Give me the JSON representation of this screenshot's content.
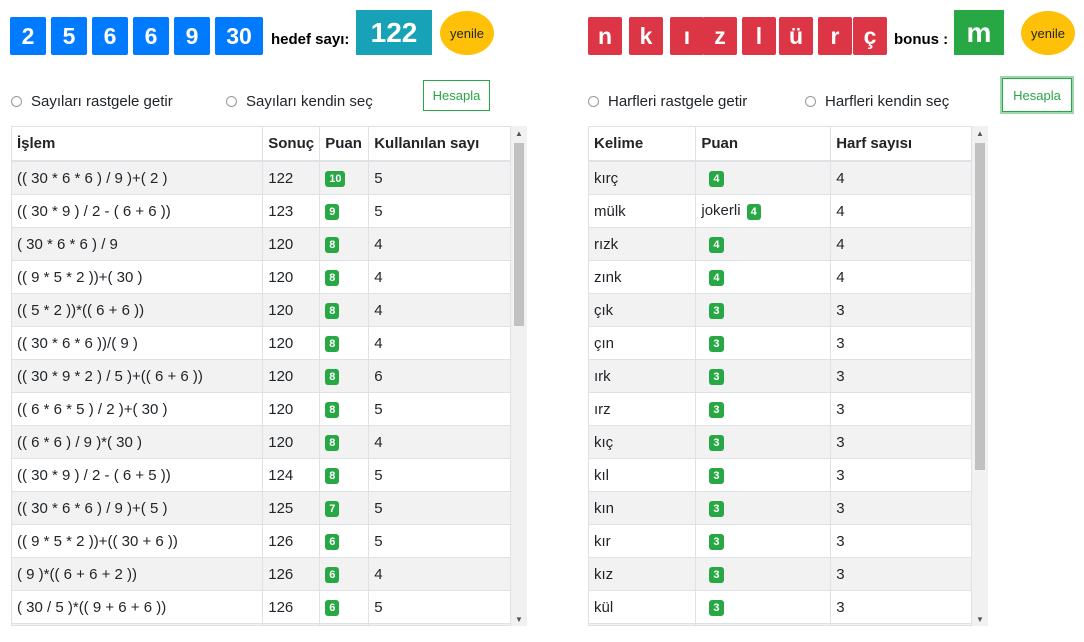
{
  "numbers": {
    "tiles": [
      "2",
      "5",
      "6",
      "6",
      "9",
      "30"
    ],
    "target_label": "hedef sayı:",
    "target_value": "122",
    "refresh_label": "yenile",
    "radio_random": "Sayıları rastgele getir",
    "radio_choose": "Sayıları kendin seç",
    "calculate_label": "Hesapla",
    "table": {
      "headers": [
        "İşlem",
        "Sonuç",
        "Puan",
        "Kullanılan sayı"
      ],
      "rows": [
        {
          "op": "(( 30 * 6 * 6 ) / 9 )+( 2 )",
          "result": "122",
          "score": "10",
          "used": "5"
        },
        {
          "op": "(( 30 * 9 ) / 2 - ( 6 + 6 ))",
          "result": "123",
          "score": "9",
          "used": "5"
        },
        {
          "op": "( 30 * 6 * 6 ) / 9",
          "result": "120",
          "score": "8",
          "used": "4"
        },
        {
          "op": "(( 9 * 5 * 2 ))+( 30 )",
          "result": "120",
          "score": "8",
          "used": "4"
        },
        {
          "op": "(( 5 * 2 ))*(( 6 + 6 ))",
          "result": "120",
          "score": "8",
          "used": "4"
        },
        {
          "op": "(( 30 * 6 * 6 ))/( 9 )",
          "result": "120",
          "score": "8",
          "used": "4"
        },
        {
          "op": "(( 30 * 9 * 2 ) / 5 )+(( 6 + 6 ))",
          "result": "120",
          "score": "8",
          "used": "6"
        },
        {
          "op": "(( 6 * 6 * 5 ) / 2 )+( 30 )",
          "result": "120",
          "score": "8",
          "used": "5"
        },
        {
          "op": "(( 6 * 6 ) / 9 )*( 30 )",
          "result": "120",
          "score": "8",
          "used": "4"
        },
        {
          "op": "(( 30 * 9 ) / 2 - ( 6 + 5 ))",
          "result": "124",
          "score": "8",
          "used": "5"
        },
        {
          "op": "(( 30 * 6 * 6 ) / 9 )+( 5 )",
          "result": "125",
          "score": "7",
          "used": "5"
        },
        {
          "op": "(( 9 * 5 * 2 ))+(( 30 + 6 ))",
          "result": "126",
          "score": "6",
          "used": "5"
        },
        {
          "op": "( 9 )*(( 6 + 6 + 2 ))",
          "result": "126",
          "score": "6",
          "used": "4"
        },
        {
          "op": "( 30 / 5 )*(( 9 + 6 + 6 ))",
          "result": "126",
          "score": "6",
          "used": "5"
        },
        {
          "op": "",
          "result": "",
          "score": "",
          "used": ""
        }
      ]
    }
  },
  "letters": {
    "tiles": [
      "n",
      "k",
      "ı",
      "z",
      "l",
      "ü",
      "r",
      "ç"
    ],
    "bonus_label": "bonus :",
    "bonus_value": "m",
    "refresh_label": "yenile",
    "radio_random": "Harfleri rastgele getir",
    "radio_choose": "Harfleri kendin seç",
    "calculate_label": "Hesapla",
    "table": {
      "headers": [
        "Kelime",
        "Puan",
        "Harf sayısı"
      ],
      "rows": [
        {
          "word": "kırç",
          "joker": "",
          "score": "4",
          "count": "4"
        },
        {
          "word": "mülk",
          "joker": "jokerli",
          "score": "4",
          "count": "4"
        },
        {
          "word": "rızk",
          "joker": "",
          "score": "4",
          "count": "4"
        },
        {
          "word": "zınk",
          "joker": "",
          "score": "4",
          "count": "4"
        },
        {
          "word": "çık",
          "joker": "",
          "score": "3",
          "count": "3"
        },
        {
          "word": "çın",
          "joker": "",
          "score": "3",
          "count": "3"
        },
        {
          "word": "ırk",
          "joker": "",
          "score": "3",
          "count": "3"
        },
        {
          "word": "ırz",
          "joker": "",
          "score": "3",
          "count": "3"
        },
        {
          "word": "kıç",
          "joker": "",
          "score": "3",
          "count": "3"
        },
        {
          "word": "kıl",
          "joker": "",
          "score": "3",
          "count": "3"
        },
        {
          "word": "kın",
          "joker": "",
          "score": "3",
          "count": "3"
        },
        {
          "word": "kır",
          "joker": "",
          "score": "3",
          "count": "3"
        },
        {
          "word": "kız",
          "joker": "",
          "score": "3",
          "count": "3"
        },
        {
          "word": "kül",
          "joker": "",
          "score": "3",
          "count": "3"
        },
        {
          "word": "",
          "joker": "",
          "score": "",
          "count": ""
        }
      ]
    }
  },
  "colors": {
    "number_tile": "#007bff",
    "target_box": "#17a2b8",
    "letter_tile": "#dc3545",
    "bonus_box": "#28a745",
    "refresh": "#ffc107",
    "badge": "#28a745"
  }
}
